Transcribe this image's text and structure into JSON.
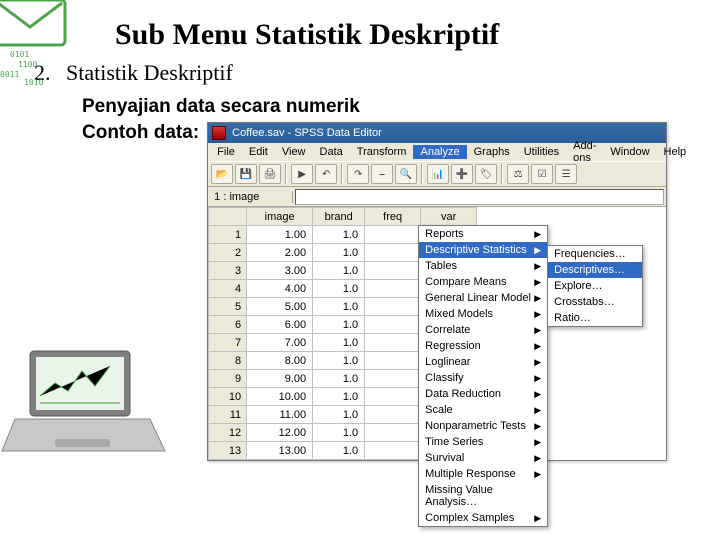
{
  "slide": {
    "title": "Sub Menu Statistik Deskriptif",
    "list_num": "2.",
    "list_text": "Statistik Deskriptif",
    "sub1": "Penyajian data secara numerik",
    "sub2": "Contoh data:"
  },
  "spss": {
    "title": "Coffee.sav - SPSS Data Editor",
    "menubar": [
      "File",
      "Edit",
      "View",
      "Data",
      "Transform",
      "Analyze",
      "Graphs",
      "Utilities",
      "Add-ons",
      "Window",
      "Help"
    ],
    "toolbar_icons": [
      "open-icon",
      "save-icon",
      "print-icon",
      "run-icon",
      "undo-icon",
      "redo-icon",
      "goto-icon",
      "find-icon",
      "chart-icon",
      "insert-icon",
      "labels-icon",
      "weight-icon",
      "select-icon",
      "vars-icon"
    ],
    "cell_name": "1 : image",
    "columns": [
      "image",
      "brand",
      "freq",
      "var"
    ],
    "rows": [
      {
        "n": "1",
        "image": "1.00",
        "brand": "1.0"
      },
      {
        "n": "2",
        "image": "2.00",
        "brand": "1.0"
      },
      {
        "n": "3",
        "image": "3.00",
        "brand": "1.0"
      },
      {
        "n": "4",
        "image": "4.00",
        "brand": "1.0"
      },
      {
        "n": "5",
        "image": "5.00",
        "brand": "1.0"
      },
      {
        "n": "6",
        "image": "6.00",
        "brand": "1.0"
      },
      {
        "n": "7",
        "image": "7.00",
        "brand": "1.0"
      },
      {
        "n": "8",
        "image": "8.00",
        "brand": "1.0"
      },
      {
        "n": "9",
        "image": "9.00",
        "brand": "1.0"
      },
      {
        "n": "10",
        "image": "10.00",
        "brand": "1.0"
      },
      {
        "n": "11",
        "image": "11.00",
        "brand": "1.0"
      },
      {
        "n": "12",
        "image": "12.00",
        "brand": "1.0"
      },
      {
        "n": "13",
        "image": "13.00",
        "brand": "1.0"
      }
    ],
    "analyze_menu": [
      {
        "label": "Reports",
        "sub": true
      },
      {
        "label": "Descriptive Statistics",
        "sub": true,
        "hl": true
      },
      {
        "label": "Tables",
        "sub": true
      },
      {
        "label": "Compare Means",
        "sub": true
      },
      {
        "label": "General Linear Model",
        "sub": true
      },
      {
        "label": "Mixed Models",
        "sub": true
      },
      {
        "label": "Correlate",
        "sub": true
      },
      {
        "label": "Regression",
        "sub": true
      },
      {
        "label": "Loglinear",
        "sub": true
      },
      {
        "label": "Classify",
        "sub": true
      },
      {
        "label": "Data Reduction",
        "sub": true
      },
      {
        "label": "Scale",
        "sub": true
      },
      {
        "label": "Nonparametric Tests",
        "sub": true
      },
      {
        "label": "Time Series",
        "sub": true
      },
      {
        "label": "Survival",
        "sub": true
      },
      {
        "label": "Multiple Response",
        "sub": true
      },
      {
        "label": "Missing Value Analysis…",
        "sub": false
      },
      {
        "label": "Complex Samples",
        "sub": true
      }
    ],
    "desc_submenu": [
      {
        "label": "Frequencies…"
      },
      {
        "label": "Descriptives…",
        "hl": true
      },
      {
        "label": "Explore…"
      },
      {
        "label": "Crosstabs…"
      },
      {
        "label": "Ratio…"
      }
    ]
  }
}
